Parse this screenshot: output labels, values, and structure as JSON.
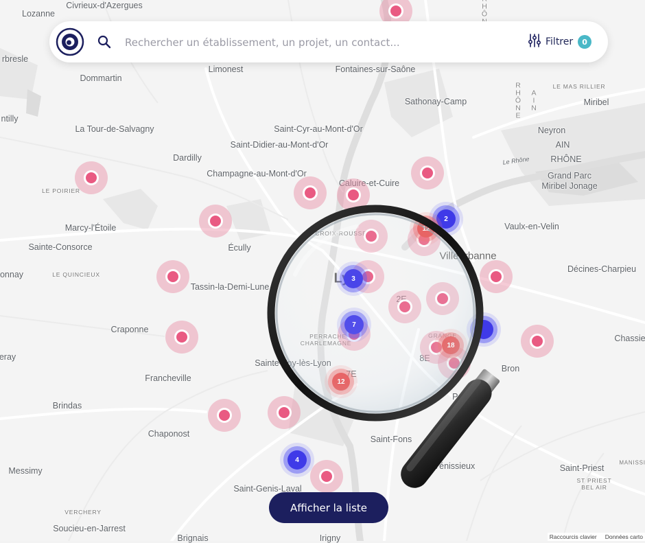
{
  "search": {
    "placeholder": "Rechercher un établissement, un projet, un contact...",
    "value": "",
    "filter_label": "Filtrer",
    "filter_count": "0"
  },
  "actions": {
    "show_list_label": "Afficher la liste"
  },
  "attribution": {
    "shortcuts": "Raccourcis clavier",
    "data": "Données carto"
  },
  "colors": {
    "navy": "#1c1f5e",
    "accent": "#4ab8c7",
    "marker_pink": "#e95a82",
    "cluster_blue": "#3f3ae8",
    "cluster_red": "#e84a4a"
  },
  "places": [
    {
      "name": "Civrieux-d'Azergues"
    },
    {
      "name": "Lozanne"
    },
    {
      "name": "rbresle"
    },
    {
      "name": "Limonest"
    },
    {
      "name": "Fontaines-sur-Saône"
    },
    {
      "name": "Dommartin"
    },
    {
      "name": "Sathonay-Camp"
    },
    {
      "name": "LE MAS RILLIER"
    },
    {
      "name": "Miribel"
    },
    {
      "name": "ntilly"
    },
    {
      "name": "La Tour-de-Salvagny"
    },
    {
      "name": "Saint-Cyr-au-Mont-d'Or"
    },
    {
      "name": "Saint-Didier-au-Mont-d'Or"
    },
    {
      "name": "Neyron"
    },
    {
      "name": "AIN"
    },
    {
      "name": "RHÔNE"
    },
    {
      "name": "Le Rhône"
    },
    {
      "name": "Dardilly"
    },
    {
      "name": "Champagne-au-Mont-d'Or"
    },
    {
      "name": "Caluire-et-Cuire"
    },
    {
      "name": "Grand Parc"
    },
    {
      "name": "Miribel Jonage"
    },
    {
      "name": "LE POIRIER"
    },
    {
      "name": "Marcy-l'Étoile"
    },
    {
      "name": "Vaulx-en-Velin"
    },
    {
      "name": "Sainte-Consorce"
    },
    {
      "name": "Écully"
    },
    {
      "name": "CROIX-ROUSSE"
    },
    {
      "name": "Villeurbanne"
    },
    {
      "name": "onnay"
    },
    {
      "name": "LE QUINCIEUX"
    },
    {
      "name": "Tassin-la-Demi-Lune"
    },
    {
      "name": "Lyon"
    },
    {
      "name": "Décines-Charpieu"
    },
    {
      "name": "Craponne"
    },
    {
      "name": "PERRACHE"
    },
    {
      "name": "CHARLEMAGNE"
    },
    {
      "name": "Chassie"
    },
    {
      "name": "eray"
    },
    {
      "name": "Sainte-Foy-lès-Lyon"
    },
    {
      "name": "8E"
    },
    {
      "name": "Bron"
    },
    {
      "name": "Francheville"
    },
    {
      "name": "7E"
    },
    {
      "name": "Parc"
    },
    {
      "name": "Brindas"
    },
    {
      "name": "Chaponost"
    },
    {
      "name": "Saint-Fons"
    },
    {
      "name": "Messimy"
    },
    {
      "name": "Vénissieux"
    },
    {
      "name": "Saint-Priest"
    },
    {
      "name": "ST PRIEST"
    },
    {
      "name": "BEL AIR"
    },
    {
      "name": "Saint-Genis-Laval"
    },
    {
      "name": "VERCHERY"
    },
    {
      "name": "Soucieu-en-Jarrest"
    },
    {
      "name": "Brignais"
    },
    {
      "name": "Irigny"
    },
    {
      "name": "RHÔNE"
    },
    {
      "name": "AIN"
    },
    {
      "name": "RHÔNE"
    },
    {
      "name": "MANISSIEUX"
    },
    {
      "name": "2E"
    },
    {
      "name": "GRANGE"
    }
  ],
  "clusters": [
    {
      "count": "2",
      "color": "blue"
    },
    {
      "count": "12",
      "color": "red"
    },
    {
      "count": "3",
      "color": "blue"
    },
    {
      "count": "7",
      "color": "blue"
    },
    {
      "count": "18",
      "color": "red"
    },
    {
      "count": "12",
      "color": "red"
    },
    {
      "count": "4",
      "color": "blue"
    },
    {
      "count": "",
      "color": "blue"
    }
  ]
}
